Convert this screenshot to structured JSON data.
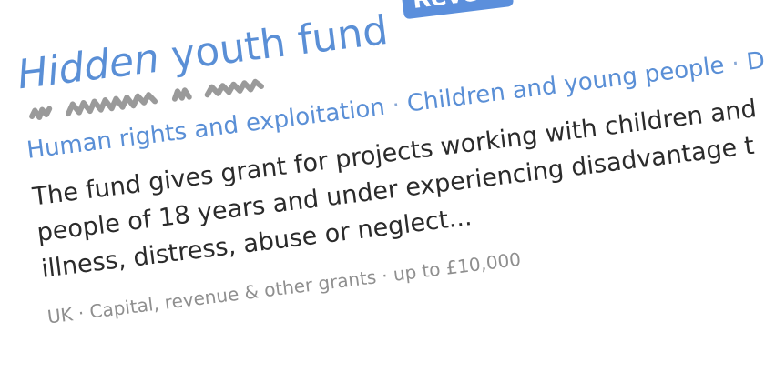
{
  "fund": {
    "title_hidden_word": "Hidden",
    "title_rest": "youth fund",
    "reveal_label": "Reveal",
    "tags": [
      "Human rights and exploitation",
      "Children and young people",
      "Di"
    ],
    "tag_separator": "·",
    "description_lines": [
      "The fund gives grant for projects working with children and",
      "people of 18 years and under experiencing disadvantage t",
      "illness, distress, abuse or neglect..."
    ],
    "meta": "UK · Capital, revenue & other grants · up to £10,000"
  },
  "colors": {
    "accent": "#5a8fd6",
    "button": "#5b8fdc",
    "text": "#2b2b2b",
    "muted": "#8f8f8f",
    "scribble": "#9a9a9a"
  }
}
